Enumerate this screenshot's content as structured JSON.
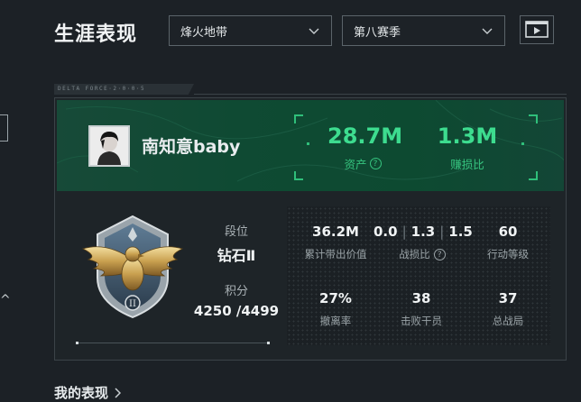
{
  "header": {
    "title": "生涯表现",
    "mode_dropdown": "烽火地带",
    "season_dropdown": "第八赛季"
  },
  "card": {
    "tag": "DELTA FORCE·2·0·0·5",
    "player": {
      "name": "南知意baby"
    },
    "assets": {
      "value": "28.7M",
      "label": "资产"
    },
    "profit_ratio": {
      "value": "1.3M",
      "label": "赚损比"
    },
    "rank": {
      "level_label": "段位",
      "level_value": "钻石Ⅱ",
      "score_label": "积分",
      "score_value": "4250 /4499"
    },
    "stats": {
      "carry_value": {
        "value": "36.2M",
        "label": "累计带出价值"
      },
      "kd": {
        "values": [
          "0.0",
          "1.3",
          "1.5"
        ],
        "label": "战损比"
      },
      "action_level": {
        "value": "60",
        "label": "行动等级"
      },
      "extract_rate": {
        "value": "27%",
        "label": "撤离率"
      },
      "kills": {
        "value": "38",
        "label": "击败干员"
      },
      "matches": {
        "value": "37",
        "label": "总战局"
      }
    }
  },
  "footer": {
    "section_title": "我的表现"
  },
  "colors": {
    "accent_green": "#3ddc8f",
    "banner_green": "#0f4a33",
    "background": "#1c2126"
  }
}
